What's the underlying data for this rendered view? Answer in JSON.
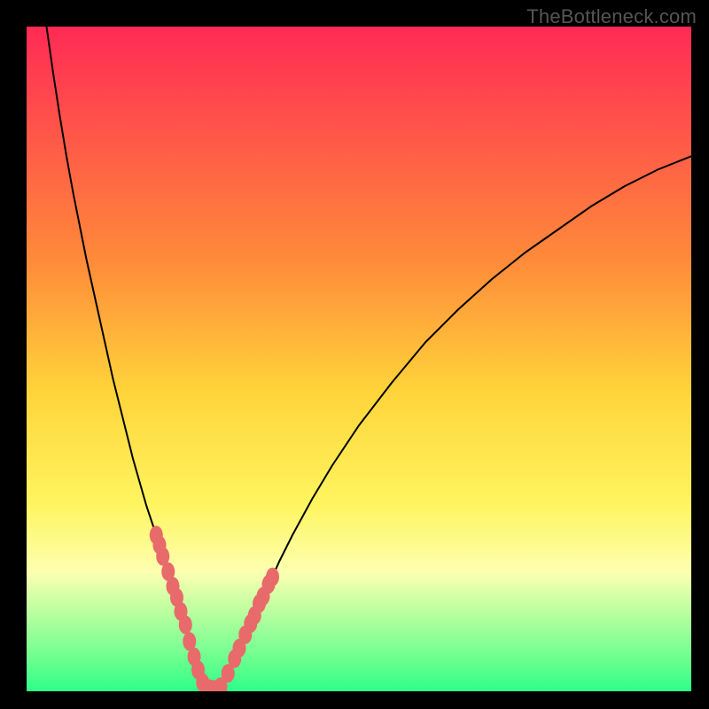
{
  "watermark": "TheBottleneck.com",
  "chart_data": {
    "type": "line",
    "title": "",
    "xlabel": "",
    "ylabel": "",
    "xlim": [
      0,
      100
    ],
    "ylim": [
      0,
      100
    ],
    "background_gradient_stops": [
      {
        "pos": 0.0,
        "color": "#ff2a55"
      },
      {
        "pos": 0.35,
        "color": "#ff8a3a"
      },
      {
        "pos": 0.55,
        "color": "#ffd43a"
      },
      {
        "pos": 0.72,
        "color": "#fff560"
      },
      {
        "pos": 0.82,
        "color": "#fdffb0"
      },
      {
        "pos": 0.95,
        "color": "#6eff8e"
      },
      {
        "pos": 1.0,
        "color": "#2dff8a"
      }
    ],
    "series": [
      {
        "name": "bottleneck-curve",
        "color": "#000000",
        "stroke_width": 2,
        "x": [
          3,
          4,
          5,
          6,
          7,
          8,
          9,
          10,
          11,
          12,
          13,
          14,
          15,
          16,
          17,
          18,
          19,
          20,
          21,
          22,
          23,
          24,
          24.5,
          25,
          25.5,
          26,
          27,
          28,
          29,
          30,
          32,
          34,
          36,
          38,
          40,
          43,
          46,
          50,
          55,
          60,
          65,
          70,
          75,
          80,
          85,
          90,
          95,
          100
        ],
        "y": [
          100,
          93,
          86.5,
          80.5,
          75,
          70,
          65,
          60.5,
          56,
          51.5,
          47,
          43,
          39,
          35,
          31.5,
          28,
          25,
          22,
          19,
          16,
          13,
          10,
          8,
          6,
          4,
          2,
          0.5,
          0,
          0.5,
          2,
          6,
          10.5,
          15,
          19.5,
          23.5,
          29,
          34,
          40,
          46.5,
          52.5,
          57.5,
          62,
          66,
          69.5,
          73,
          76,
          78.5,
          80.5
        ]
      }
    ],
    "bead_clusters": [
      {
        "color": "#e86a6a",
        "points": [
          {
            "x": 19.5,
            "y": 23.5
          },
          {
            "x": 20.0,
            "y": 22.0
          },
          {
            "x": 20.5,
            "y": 20.3
          },
          {
            "x": 21.3,
            "y": 18.0
          },
          {
            "x": 22.0,
            "y": 15.8
          },
          {
            "x": 22.6,
            "y": 14.1
          },
          {
            "x": 23.2,
            "y": 12.0
          },
          {
            "x": 23.9,
            "y": 10.0
          },
          {
            "x": 24.5,
            "y": 7.5
          },
          {
            "x": 25.2,
            "y": 5.2
          },
          {
            "x": 25.8,
            "y": 3.2
          },
          {
            "x": 26.5,
            "y": 1.3
          },
          {
            "x": 27.5,
            "y": 0.4
          },
          {
            "x": 28.3,
            "y": 0.3
          },
          {
            "x": 29.2,
            "y": 0.7
          },
          {
            "x": 30.3,
            "y": 2.7
          },
          {
            "x": 31.3,
            "y": 4.9
          },
          {
            "x": 32.0,
            "y": 6.5
          },
          {
            "x": 32.9,
            "y": 8.5
          },
          {
            "x": 33.7,
            "y": 10.2
          },
          {
            "x": 34.3,
            "y": 11.4
          },
          {
            "x": 35.0,
            "y": 13.2
          },
          {
            "x": 35.6,
            "y": 14.3
          },
          {
            "x": 36.4,
            "y": 16.1
          },
          {
            "x": 37.0,
            "y": 17.2
          }
        ]
      }
    ]
  }
}
